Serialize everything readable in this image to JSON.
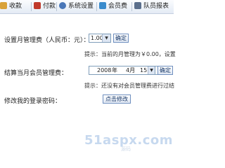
{
  "tabs": [
    {
      "label": "收款",
      "icon": "cash-icon",
      "color": "#d9a23a"
    },
    {
      "label": "付款",
      "icon": "payment-icon",
      "color": "#c0392b"
    },
    {
      "label": "系统设置",
      "icon": "settings-icon",
      "color": "#4a77b8"
    },
    {
      "label": "会员费",
      "icon": "member-fee-icon",
      "color": "#3a8bcd"
    },
    {
      "label": "队员报表",
      "icon": "report-icon",
      "color": "#5a6e8c"
    }
  ],
  "fee_setting": {
    "label": "设置月管理费（人民币：元）：",
    "value": "1.00",
    "confirm": "确定",
    "hint": "提示：当前的月管理为￥0.00，设置"
  },
  "settle": {
    "label": "结算当月会员管理费：",
    "year": "2008",
    "year_suffix": "年",
    "month": "4月",
    "day": "15日",
    "confirm": "确定",
    "hint": "提示：还没有对会员管理费进行过结"
  },
  "password": {
    "label": "修改我的登录密码：",
    "button": "点击修改"
  },
  "watermark": {
    "text": "51aspx.com",
    "sub": "源码"
  }
}
